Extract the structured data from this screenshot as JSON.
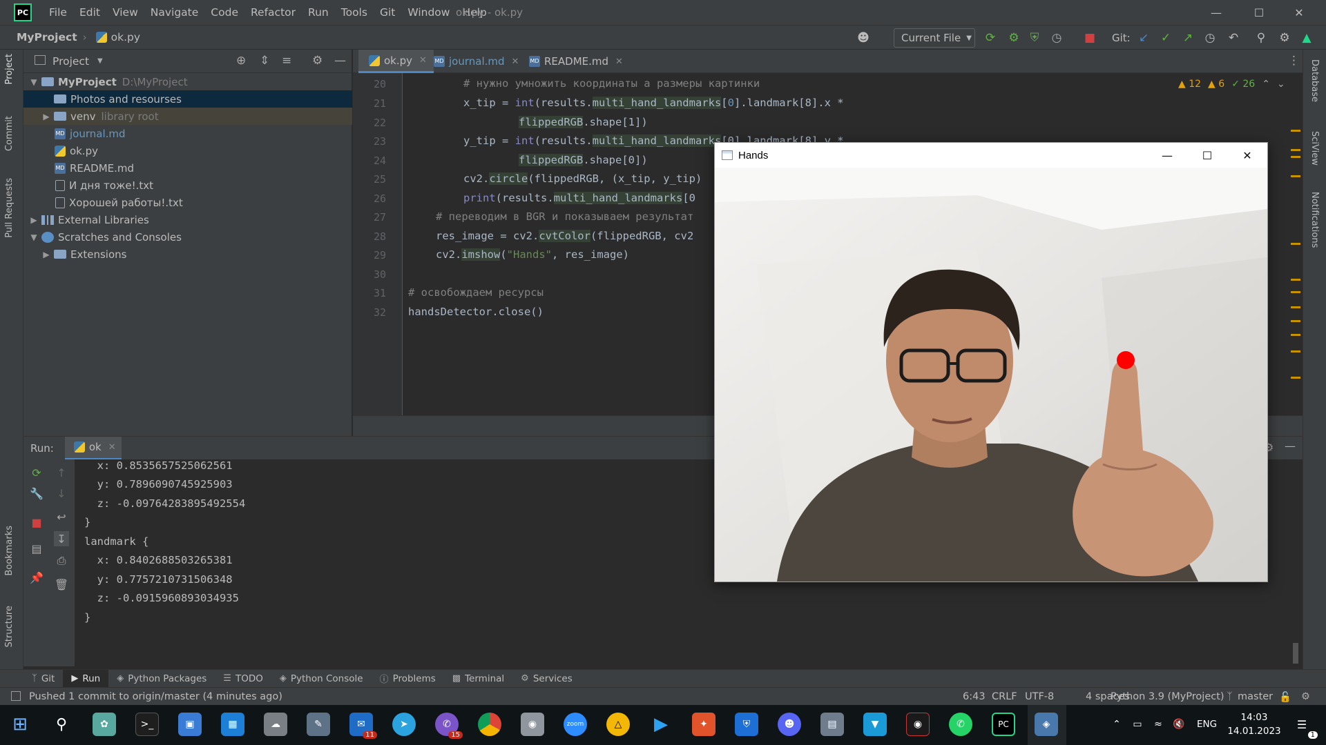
{
  "titlebar": {
    "logo": "PC",
    "menu": [
      "File",
      "Edit",
      "View",
      "Navigate",
      "Code",
      "Refactor",
      "Run",
      "Tools",
      "Git",
      "Window",
      "Help"
    ],
    "window_title": "ok.py - ok.py"
  },
  "navbar": {
    "project": "MyProject",
    "file": "ok.py",
    "run_config": "Current File",
    "git_label": "Git:"
  },
  "project_panel": {
    "title": "Project",
    "tree": [
      {
        "label": "MyProject",
        "extra": "D:\\MyProject",
        "kind": "root"
      },
      {
        "label": "Photos and resourses",
        "kind": "folder"
      },
      {
        "label": "venv",
        "extra": "library root",
        "kind": "folder"
      },
      {
        "label": "journal.md",
        "kind": "md"
      },
      {
        "label": "ok.py",
        "kind": "py"
      },
      {
        "label": "README.md",
        "kind": "md"
      },
      {
        "label": "И дня тоже!.txt",
        "kind": "txt"
      },
      {
        "label": "Хорошей работы!.txt",
        "kind": "txt"
      },
      {
        "label": "External Libraries",
        "kind": "lib"
      },
      {
        "label": "Scratches and Consoles",
        "kind": "scratch"
      },
      {
        "label": "Extensions",
        "kind": "folder"
      }
    ]
  },
  "editor": {
    "tabs": [
      {
        "label": "ok.py",
        "active": true
      },
      {
        "label": "journal.md",
        "active": false
      },
      {
        "label": "README.md",
        "active": false
      }
    ],
    "inspections": {
      "warnings": "12",
      "weak_warnings": "6",
      "ok": "26"
    },
    "line_numbers": [
      "20",
      "21",
      "22",
      "23",
      "24",
      "25",
      "26",
      "27",
      "28",
      "29",
      "30",
      "31",
      "32"
    ],
    "lines": [
      {
        "plain": "# нужно умножить координаты а размеры картинки"
      },
      {
        "a": "x_tip = ",
        "fn": "int",
        "b": "(results.",
        "hl": "multi_hand_landmarks",
        "c": "[",
        "n": "0",
        "d": "].landmark[8].x *"
      },
      {
        "a": "flippedRGB",
        "b": ".shape[1])"
      },
      {
        "a": "y_tip = ",
        "fn": "int",
        "b": "(results.",
        "hl": "multi_hand_landmarks",
        "c": "[0].landmark[8].y *"
      },
      {
        "a": "flippedRGB",
        "b": ".shape[0])"
      },
      {
        "a": "cv2.",
        "hl": "circle",
        "b": "(flippedRGB, (x_tip, y_tip)"
      },
      {
        "fn": "print",
        "b": "(results.",
        "hl": "multi_hand_landmarks",
        "c": "[0"
      },
      {
        "plain": "# переводим в BGR и показываем результат"
      },
      {
        "a": "res_image = cv2.",
        "hl": "cvtColor",
        "b": "(flippedRGB, cv2"
      },
      {
        "a": "cv2.",
        "hl": "imshow",
        "b": "(",
        "s": "\"Hands\"",
        "c": ", res_image)"
      },
      {
        "a": ""
      },
      {
        "plain": "# освобождаем ресурсы"
      },
      {
        "a": "handsDetector.close()"
      }
    ]
  },
  "run_panel": {
    "label": "Run:",
    "tab": "ok",
    "console": [
      "  x: 0.8535657525062561",
      "  y: 0.7896090745925903",
      "  z: -0.09764283895492554",
      "}",
      "landmark {",
      "  x: 0.8402688503265381",
      "  y: 0.7757210731506348",
      "  z: -0.0915960893034935",
      "}"
    ]
  },
  "left_stripe": {
    "top": [
      "Project",
      "Commit",
      "Pull Requests"
    ],
    "bottom": [
      "Bookmarks",
      "Structure"
    ]
  },
  "right_stripe": [
    "Database",
    "SciView",
    "Notifications"
  ],
  "tool_tabs": [
    "Git",
    "Run",
    "Python Packages",
    "TODO",
    "Python Console",
    "Problems",
    "Terminal",
    "Services"
  ],
  "statusbar": {
    "message": "Pushed 1 commit to origin/master (4 minutes ago)",
    "position": "6:43",
    "line_sep": "CRLF",
    "encoding": "UTF-8",
    "indent": "4 spaces",
    "interpreter": "Python 3.9 (MyProject)",
    "branch": "master"
  },
  "hands_window": {
    "title": "Hands"
  },
  "taskbar": {
    "mail_badge": "11",
    "viber_badge": "15",
    "lang": "ENG",
    "time": "14:03",
    "date": "14.01.2023",
    "notif_count": "1"
  },
  "colors": {
    "accent": "#4a88c7",
    "warning": "#e2a10d",
    "ok": "#5fb340",
    "fingertip": "#ff0000"
  }
}
